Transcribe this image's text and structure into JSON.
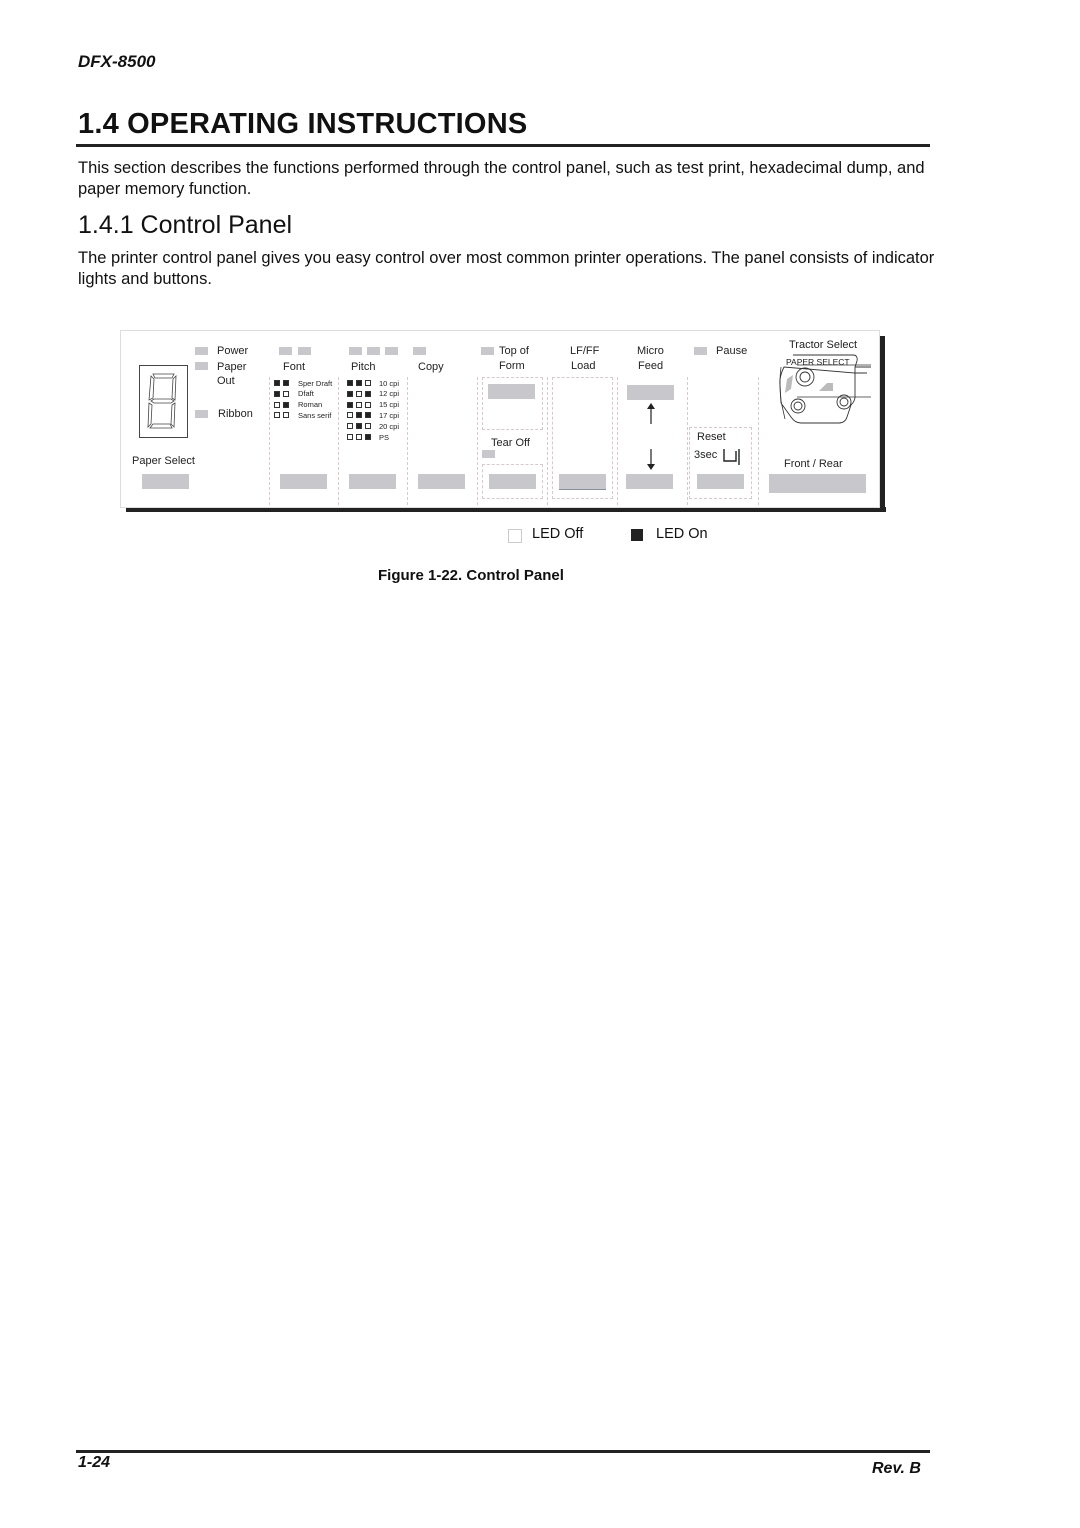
{
  "header": {
    "model": "DFX-8500"
  },
  "section": {
    "title": "1.4 OPERATING INSTRUCTIONS",
    "intro": "This section describes the functions performed through the control panel, such as test print, hexadecimal dump, and paper memory function."
  },
  "subsection": {
    "title": "1.4.1  Control Panel",
    "description": "The printer control panel gives you easy control over most common printer operations. The panel consists of indicator lights and buttons."
  },
  "panel": {
    "indicators": {
      "power": "Power",
      "paper_out_1": "Paper",
      "paper_out_2": "Out",
      "ribbon": "Ribbon"
    },
    "paper_select": "Paper Select",
    "font": {
      "label": "Font",
      "options": [
        {
          "name": "Sper Draft",
          "leds": [
            1,
            1
          ]
        },
        {
          "name": "Dfaft",
          "leds": [
            1,
            0
          ]
        },
        {
          "name": "Roman",
          "leds": [
            0,
            1
          ]
        },
        {
          "name": "Sans serif",
          "leds": [
            0,
            0
          ]
        }
      ]
    },
    "pitch": {
      "label": "Pitch",
      "options": [
        {
          "name": "10 cpi",
          "leds": [
            1,
            1,
            0
          ]
        },
        {
          "name": "12 cpi",
          "leds": [
            1,
            0,
            1
          ]
        },
        {
          "name": "15 cpi",
          "leds": [
            1,
            0,
            0
          ]
        },
        {
          "name": "17 cpi",
          "leds": [
            0,
            1,
            1
          ]
        },
        {
          "name": "20 cpi",
          "leds": [
            0,
            1,
            0
          ]
        },
        {
          "name": "PS",
          "leds": [
            0,
            0,
            1
          ]
        }
      ]
    },
    "copy": "Copy",
    "top_of_form_1": "Top of",
    "top_of_form_2": "Form",
    "tear_off": "Tear Off",
    "lf_ff_1": "LF/FF",
    "lf_ff_2": "Load",
    "micro_feed_1": "Micro",
    "micro_feed_2": "Feed",
    "pause": "Pause",
    "reset": "Reset",
    "reset_time": "3sec",
    "tractor_select": "Tractor Select",
    "paper_select_plate": "PAPER SELECT",
    "front_rear": "Front / Rear"
  },
  "legend": {
    "off": "LED Off",
    "on": "LED On"
  },
  "figure": {
    "caption": "Figure 1-22. Control Panel"
  },
  "footer": {
    "page": "1-24",
    "revision": "Rev. B"
  }
}
